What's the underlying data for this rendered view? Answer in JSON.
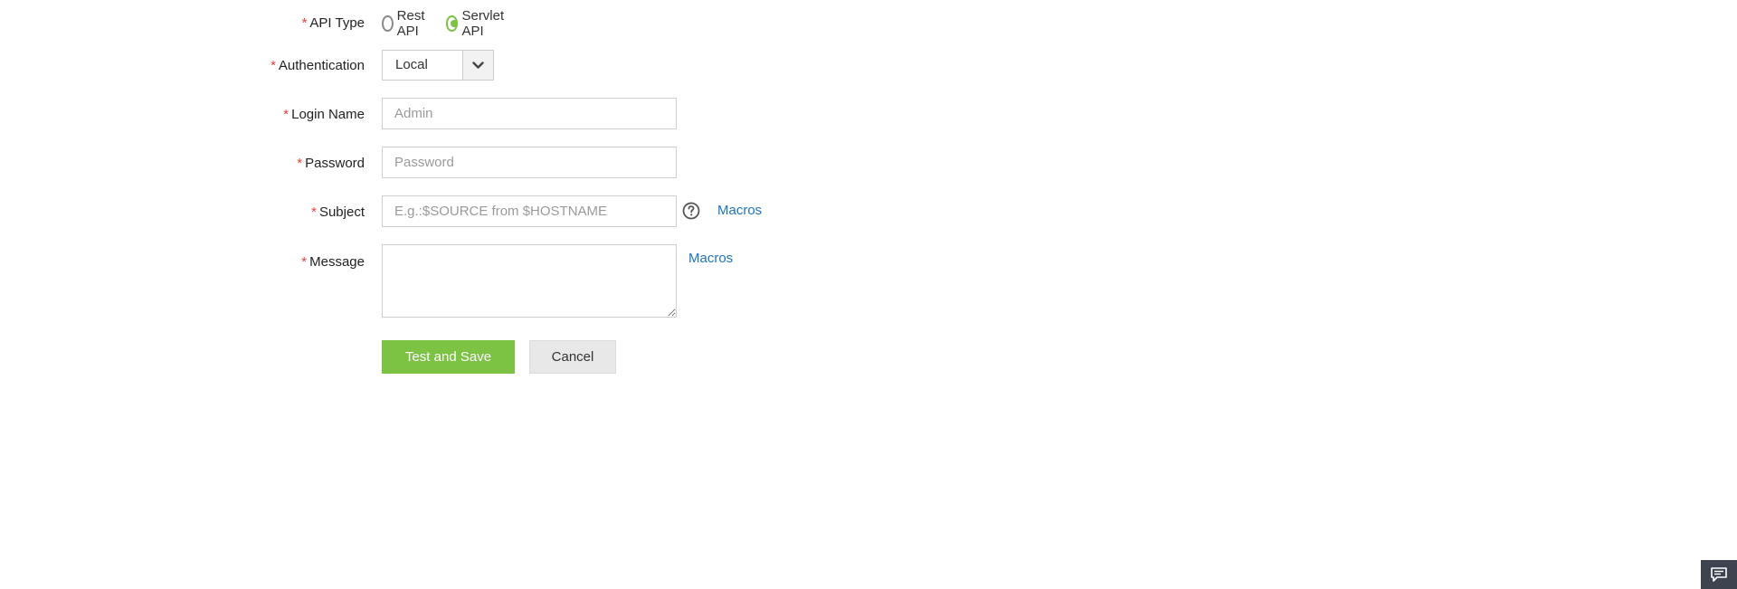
{
  "form": {
    "required_marker": "*",
    "api_type": {
      "label": "API Type",
      "options": [
        {
          "label": "Rest API",
          "checked": false
        },
        {
          "label": "Servlet API",
          "checked": true
        }
      ]
    },
    "authentication": {
      "label": "Authentication",
      "value": "Local"
    },
    "login_name": {
      "label": "Login Name",
      "placeholder": "Admin",
      "value": ""
    },
    "password": {
      "label": "Password",
      "placeholder": "Password",
      "value": ""
    },
    "subject": {
      "label": "Subject",
      "placeholder": "E.g.:$SOURCE from $HOSTNAME",
      "value": "",
      "macros_link": "Macros"
    },
    "message": {
      "label": "Message",
      "value": "",
      "macros_link": "Macros"
    },
    "actions": {
      "primary": "Test and Save",
      "cancel": "Cancel"
    }
  },
  "colors": {
    "accent_green": "#7cc243",
    "required_red": "#e8413b",
    "link_blue": "#1e73be",
    "chat_bg": "#3d4450"
  },
  "icons": {
    "help": "question-circle-icon",
    "dropdown": "chevron-down-icon",
    "chat": "chat-icon"
  }
}
